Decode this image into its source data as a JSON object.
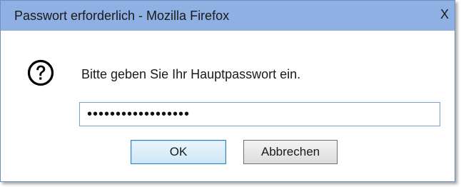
{
  "window": {
    "title": "Passwort erforderlich - Mozilla Firefox",
    "close_label": "X"
  },
  "dialog": {
    "icon": "question-icon",
    "message": "Bitte geben Sie Ihr Hauptpasswort ein.",
    "password_value": "••••••••••••••••••"
  },
  "buttons": {
    "ok_label": "OK",
    "cancel_label": "Abbrechen"
  },
  "colors": {
    "titlebar": "#8fb0e3",
    "window_border": "#6f8fbf",
    "input_border": "#7a9ccf"
  }
}
